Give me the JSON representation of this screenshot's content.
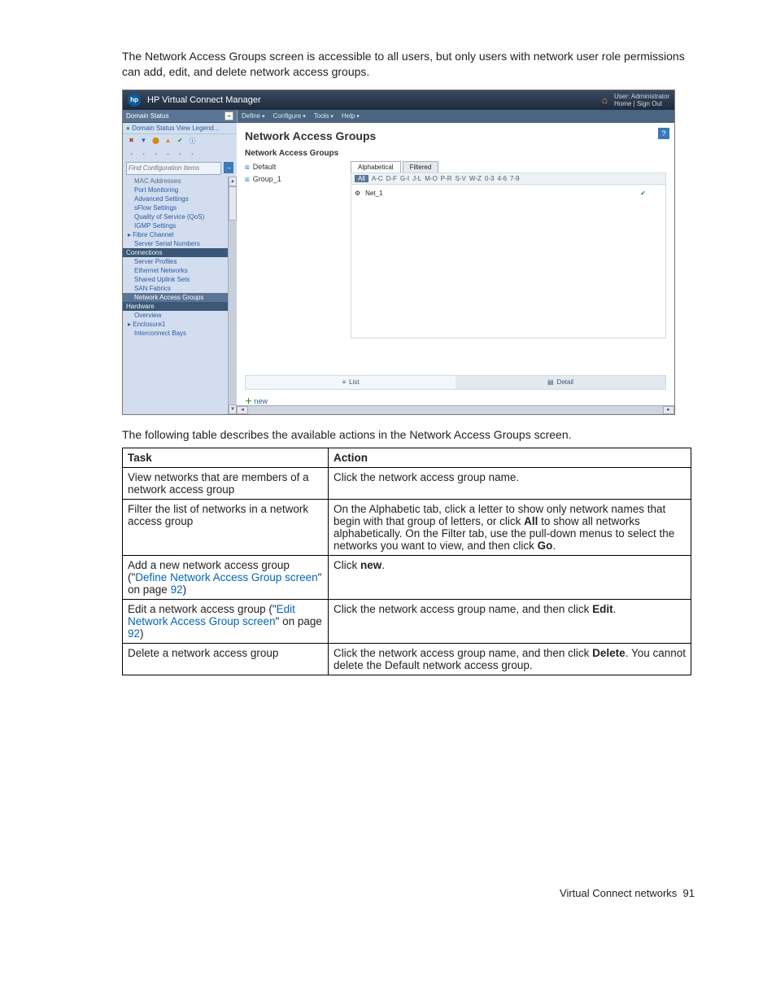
{
  "intro": "The Network Access Groups screen is accessible to all users, but only users with network user role permissions can add, edit, and delete network access groups.",
  "shot": {
    "title": "HP Virtual Connect Manager",
    "userLine1": "User: Administrator",
    "userLine2": "Home | Sign Out",
    "menus": {
      "m0": "Define",
      "m1": "Configure",
      "m2": "Tools",
      "m3": "Help"
    },
    "side": {
      "head": "Domain Status",
      "statusLink": "Domain Status   View Legend...",
      "findPlaceholder": "Find Configuration Items",
      "items": {
        "i0": "MAC Addresses",
        "i1": "Port Monitoring",
        "i2": "Advanced Settings",
        "i3": "sFlow Settings",
        "i4": "Quality of Service (QoS)",
        "i5": "IGMP Settings",
        "i6": "Fibre Channel",
        "i7": "Server Serial Numbers",
        "secConn": "Connections",
        "i8": "Server Profiles",
        "i9": "Ethernet Networks",
        "i10": "Shared Uplink Sets",
        "i11": "SAN Fabrics",
        "i12": "Network Access Groups",
        "secHw": "Hardware",
        "i13": "Overview",
        "i14": "Enclosure1",
        "i15": "Interconnect Bays"
      }
    },
    "main": {
      "h1": "Network Access Groups",
      "h2": "Network Access Groups",
      "groups": {
        "g0": "Default",
        "g1": "Group_1"
      },
      "tabs": {
        "t0": "Alphabetical",
        "t1": "Filtered"
      },
      "alpha": {
        "a0": "All",
        "a1": "A-C",
        "a2": "D-F",
        "a3": "G-I",
        "a4": "J-L",
        "a5": "M-O",
        "a6": "P-R",
        "a7": "S-V",
        "a8": "W-Z",
        "a9": "0-3",
        "a10": "4-6",
        "a11": "7-9"
      },
      "net0": "Net_1",
      "viewList": "List",
      "viewDetail": "Detail",
      "add": "new"
    }
  },
  "following": "The following table describes the available actions in the Network Access Groups screen.",
  "table": {
    "hTask": "Task",
    "hAction": "Action",
    "r1t": "View networks that are members of a network access group",
    "r1a": "Click the network access group name.",
    "r2t": "Filter the list of networks in a network access group",
    "r2a_pre": "On the Alphabetic tab, click a letter to show only network names that begin with that group of letters, or click ",
    "r2a_b1": "All",
    "r2a_mid": " to show all networks alphabetically. On the Filter tab, use the pull-down menus to select the networks you want to view, and then click ",
    "r2a_b2": "Go",
    "r2a_post": ".",
    "r3t_pre": "Add a new network access group (\"",
    "r3t_link": "Define Network Access Group screen",
    "r3t_mid": "\" on page ",
    "r3t_page": "92",
    "r3t_post": ")",
    "r3a_pre": "Click ",
    "r3a_b": "new",
    "r3a_post": ".",
    "r4t_pre": "Edit a network access group (\"",
    "r4t_link": "Edit Network Access Group screen",
    "r4t_mid": "\" on page ",
    "r4t_page": "92",
    "r4t_post": ")",
    "r4a_pre": "Click the network access group name, and then click ",
    "r4a_b": "Edit",
    "r4a_post": ".",
    "r5t": "Delete a network access group",
    "r5a_pre": "Click the network access group name, and then click ",
    "r5a_b": "Delete",
    "r5a_post": ". You cannot delete the Default network access group."
  },
  "footer": {
    "text": "Virtual Connect networks",
    "page": "91"
  }
}
